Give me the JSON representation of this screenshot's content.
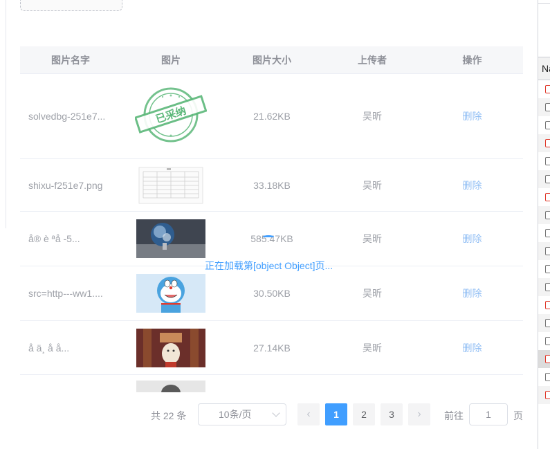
{
  "table": {
    "headers": [
      "图片名字",
      "图片",
      "图片大小",
      "上传者",
      "操作"
    ],
    "rows": [
      {
        "name": "solvedbg-251e7...",
        "thumb": "stamp-image",
        "size": "21.62KB",
        "uploader": "吴昕",
        "action": "删除"
      },
      {
        "name": "shixu-f251e7.png",
        "thumb": "document-image",
        "size": "33.18KB",
        "uploader": "吴昕",
        "action": "删除"
      },
      {
        "name": "å® è ªå  -5...",
        "thumb": "earth-moon-image",
        "size": "585.47KB",
        "uploader": "吴昕",
        "action": "删除"
      },
      {
        "name": "src=http---ww1....",
        "thumb": "doraemon-image",
        "size": "30.50KB",
        "uploader": "吴昕",
        "action": "删除"
      },
      {
        "name": "å  ä¸ å  å...",
        "thumb": "cartoon-figure-image",
        "size": "27.14KB",
        "uploader": "吴昕",
        "action": "删除"
      }
    ],
    "stamp_text": "已采纳"
  },
  "loading_text": "正在加载第[object Object]页...",
  "pagination": {
    "total": "共 22 条",
    "page_size": "10条/页",
    "pages": [
      "1",
      "2",
      "3"
    ],
    "active_page": "1",
    "prev": "‹",
    "next": "›",
    "goto_label": "前往",
    "goto_value": "1",
    "page_suffix": "页"
  },
  "side_panel": {
    "header": "Na"
  },
  "colors": {
    "accent": "#409eff",
    "link": "#8fbdf4",
    "stamp_green": "#5cb87a",
    "checkbox_red": "#e0392b"
  }
}
